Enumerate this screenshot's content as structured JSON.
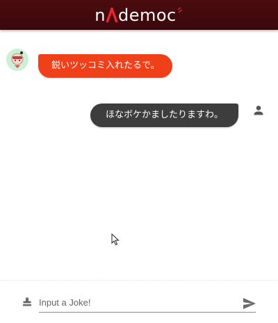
{
  "header": {
    "logo_text": "democ",
    "logo_prefix": "n",
    "background": "#3d0a0d"
  },
  "messages": [
    {
      "sender": "bot",
      "text": "鋭いツッコミ入れたるで。",
      "avatar_icon": "bot-avatar-icon",
      "color": "#f0401a"
    },
    {
      "sender": "user",
      "text": "ほなボケかましたりますわ。",
      "avatar_icon": "person-icon",
      "color": "#3d3d3d"
    }
  ],
  "composer": {
    "placeholder": "Input a Joke!",
    "value": "",
    "leading_icon": "stamp-icon",
    "send_icon": "send-icon"
  }
}
